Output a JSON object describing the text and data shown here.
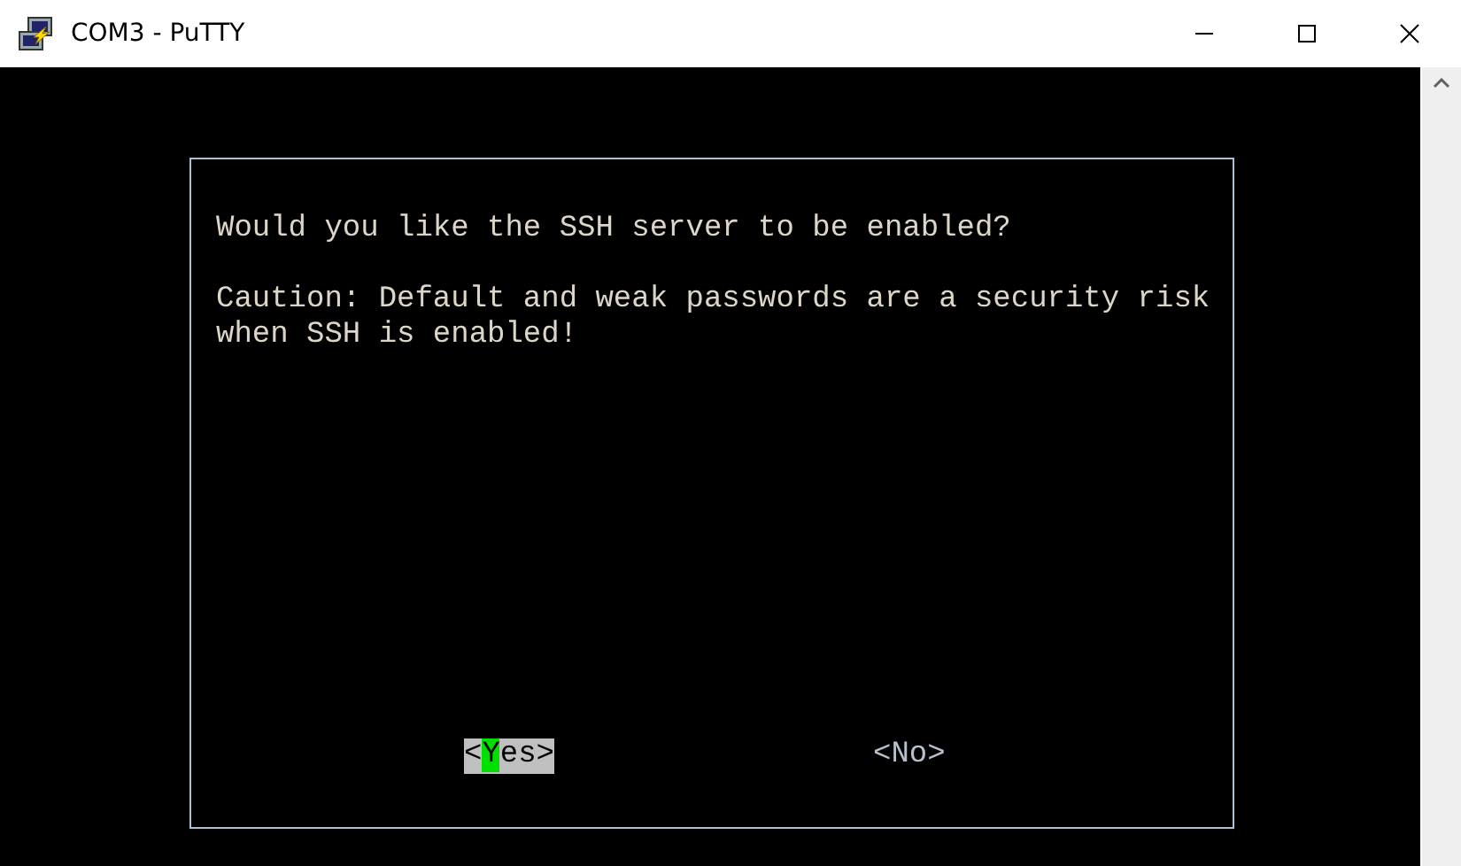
{
  "window": {
    "title": "COM3 - PuTTY"
  },
  "dialog": {
    "paragraphs": [
      [
        "Would you like the SSH server to be enabled?"
      ],
      [
        "Caution: Default and weak passwords are a security risk",
        "when SSH is enabled!"
      ]
    ],
    "buttons": [
      {
        "label": "<Yes>",
        "selected": true
      },
      {
        "label": "<No>",
        "selected": false
      }
    ]
  }
}
